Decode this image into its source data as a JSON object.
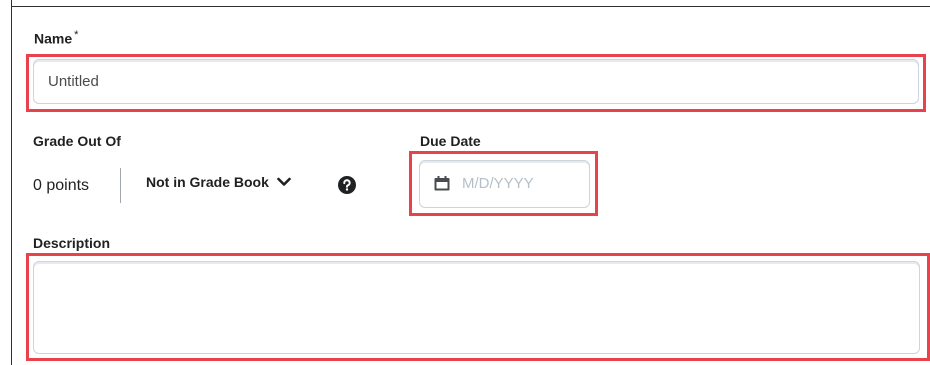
{
  "form": {
    "name": {
      "label": "Name",
      "required_mark": "*",
      "value": "Untitled"
    },
    "grade": {
      "label": "Grade Out Of",
      "points_value": "0 points",
      "gradebook_select": "Not in Grade Book",
      "help_icon": "question-circle-icon",
      "dropdown_icon": "chevron-down-icon"
    },
    "due_date": {
      "label": "Due Date",
      "placeholder": "M/D/YYYY",
      "icon": "calendar-icon"
    },
    "description": {
      "label": "Description",
      "value": ""
    }
  },
  "colors": {
    "highlight": "#e8434c",
    "field_border": "#cdd5dc",
    "placeholder": "#b6bfc8",
    "text": "#202122"
  }
}
